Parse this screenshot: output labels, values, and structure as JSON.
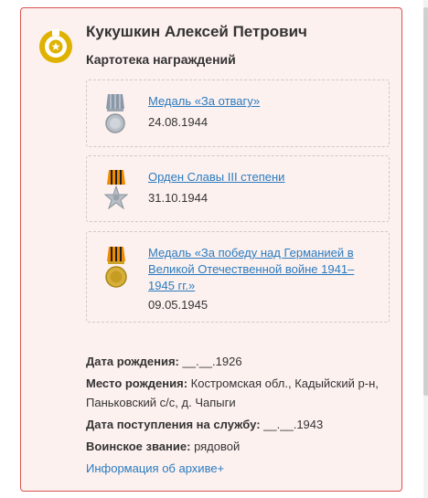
{
  "person": {
    "name": "Кукушкин Алексей Петрович",
    "subtitle": "Картотека награждений"
  },
  "awards": [
    {
      "title": "Медаль «За отвагу»",
      "date": "24.08.1944"
    },
    {
      "title": "Орден Славы III степени",
      "date": "31.10.1944"
    },
    {
      "title_lines": [
        "Медаль «За победу над Германией в",
        "Великой Отечественной войне 1941–",
        "1945 гг.»"
      ],
      "date": "09.05.1945"
    }
  ],
  "details": {
    "birth_date_label": "Дата рождения:",
    "birth_date_value": "__.__.1926",
    "birth_place_label": "Место рождения:",
    "birth_place_value_line1": "Костромская обл., Кадыйский р-н,",
    "birth_place_value_line2": "Паньковский с/с, д. Чапыги",
    "service_date_label": "Дата поступления на службу:",
    "service_date_value": "__.__.1943",
    "rank_label": "Воинское звание:",
    "rank_value": "рядовой",
    "archive_link": "Информация об архиве+"
  },
  "colors": {
    "accent_gold": "#e0b200",
    "border_red": "#d9534f",
    "link_blue": "#2a7bbf",
    "card_bg": "#fdf1ef"
  },
  "icons": [
    "medal-logo-icon",
    "medal-bravery-icon",
    "order-glory-icon",
    "medal-victory-icon"
  ]
}
